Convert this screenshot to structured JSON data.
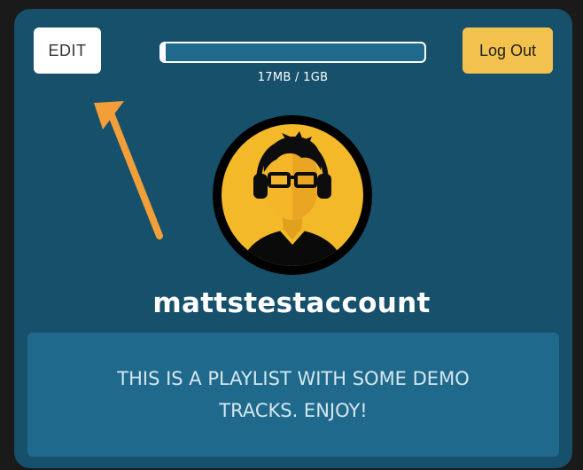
{
  "profile": {
    "edit_label": "EDIT",
    "logout_label": "Log Out",
    "storage": {
      "label": "17MB / 1GB",
      "used_fraction": 0.017
    },
    "username": "mattstestaccount",
    "description": "THIS IS A PLAYLIST WITH SOME DEMO TRACKS. ENJOY!",
    "avatar_icon": "person-with-headphones-icon"
  },
  "colors": {
    "page_background": "#1a1a1a",
    "card_background": "#16506a",
    "panel_background": "#1f6a8c",
    "logout_button": "#f2c14e",
    "edit_button": "#ffffff",
    "arrow": "#f29f3a",
    "avatar_background": "#f4b929"
  },
  "annotation": {
    "arrow_icon": "pointer-arrow-icon"
  }
}
